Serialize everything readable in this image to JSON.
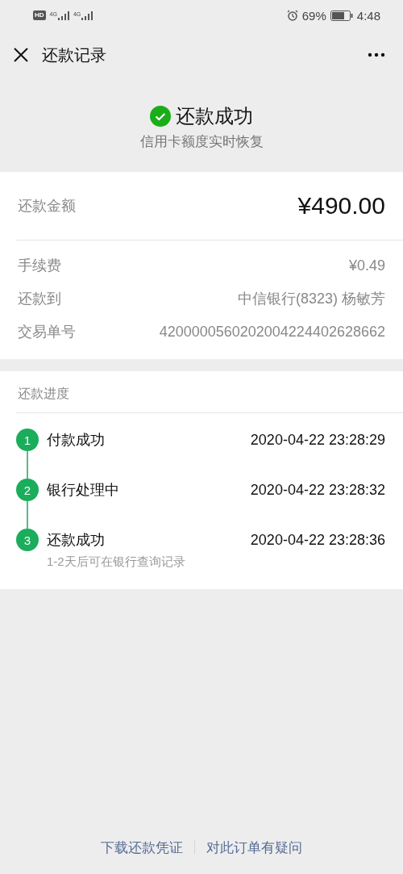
{
  "status_bar": {
    "badge": "HD",
    "sims": [
      {
        "network": "4G"
      },
      {
        "network": "4G"
      }
    ],
    "battery": "69%",
    "time": "4:48"
  },
  "header": {
    "title": "还款记录"
  },
  "result": {
    "title": "还款成功",
    "subtitle": "信用卡额度实时恢复"
  },
  "amount": {
    "label": "还款金额",
    "value": "¥490.00"
  },
  "details": [
    {
      "label": "手续费",
      "value": "¥0.49"
    },
    {
      "label": "还款到",
      "value": "中信银行(8323) 杨敏芳"
    },
    {
      "label": "交易单号",
      "value": "4200000560202004224402628662"
    }
  ],
  "progress": {
    "title": "还款进度",
    "steps": [
      {
        "number": "1",
        "label": "付款成功",
        "time": "2020-04-22 23:28:29"
      },
      {
        "number": "2",
        "label": "银行处理中",
        "time": "2020-04-22 23:28:32"
      },
      {
        "number": "3",
        "label": "还款成功",
        "time": "2020-04-22 23:28:36",
        "note": "1-2天后可在银行查询记录"
      }
    ]
  },
  "footer_links": [
    "下载还款凭证",
    "对此订单有疑问"
  ]
}
